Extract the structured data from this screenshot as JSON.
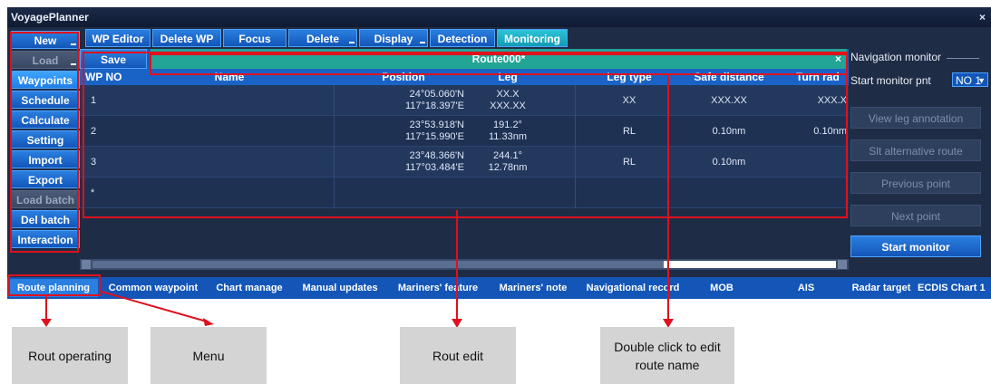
{
  "window": {
    "title": "VoyagePlanner",
    "close": "×"
  },
  "left_buttons": [
    {
      "label": "New",
      "state": "normal"
    },
    {
      "label": "Load",
      "state": "disabled"
    },
    {
      "label": "Waypoints",
      "state": "active"
    },
    {
      "label": "Schedule",
      "state": "normal"
    },
    {
      "label": "Calculate",
      "state": "normal"
    },
    {
      "label": "Setting",
      "state": "normal"
    },
    {
      "label": "Import",
      "state": "normal"
    },
    {
      "label": "Export",
      "state": "normal"
    },
    {
      "label": "Load batch",
      "state": "disabled"
    },
    {
      "label": "Del batch",
      "state": "normal"
    },
    {
      "label": "Interaction",
      "state": "normal"
    }
  ],
  "tabs": [
    "WP Editor",
    "Delete WP",
    "Focus",
    "Delete",
    "Display",
    "Detection",
    "Monitoring"
  ],
  "active_tab": "Monitoring",
  "toolbar": {
    "save_label": "Save",
    "route_name": "Route000*",
    "close": "×"
  },
  "table": {
    "columns": [
      "WP NO",
      "Name",
      "Position",
      "Leg",
      "Leg type",
      "Safe distance",
      "Turn rad"
    ],
    "rows": [
      {
        "wp_no": "1",
        "name": "",
        "lat": "24°05.060'N",
        "lon": "117°18.397'E",
        "leg1": "XX.X",
        "leg2": "XXX.XX",
        "leg_type": "XX",
        "safe": "XXX.XX",
        "turn": "XXX.X"
      },
      {
        "wp_no": "2",
        "name": "",
        "lat": "23°53.918'N",
        "lon": "117°15.990'E",
        "leg1": "191.2°",
        "leg2": "11.33nm",
        "leg_type": "RL",
        "safe": "0.10nm",
        "turn": "0.10nm"
      },
      {
        "wp_no": "3",
        "name": "",
        "lat": "23°48.366'N",
        "lon": "117°03.484'E",
        "leg1": "244.1°",
        "leg2": "12.78nm",
        "leg_type": "RL",
        "safe": "0.10nm",
        "turn": ""
      },
      {
        "wp_no": "*",
        "name": "",
        "lat": "",
        "lon": "",
        "leg1": "",
        "leg2": "",
        "leg_type": "",
        "safe": "",
        "turn": ""
      }
    ]
  },
  "nav_monitor": {
    "title": "Navigation monitor",
    "start_pnt_label": "Start monitor pnt",
    "start_pnt_value": "NO 1",
    "buttons": [
      {
        "label": "View leg annotation",
        "state": "disabled"
      },
      {
        "label": "Slt alternative route",
        "state": "disabled"
      },
      {
        "label": "Previous point",
        "state": "disabled"
      },
      {
        "label": "Next point",
        "state": "disabled"
      },
      {
        "label": "Start monitor",
        "state": "primary"
      }
    ]
  },
  "bottom_tabs": [
    "Route planning",
    "Common waypoint",
    "Chart manage",
    "Manual updates",
    "Mariners' feature",
    "Mariners' note",
    "Navigational record",
    "MOB",
    "AIS",
    "Radar target",
    "ECDIS Chart 1"
  ],
  "active_bottom_tab": "Route planning",
  "callouts": [
    "Rout  operating",
    "Menu",
    "Rout edit",
    "Double click to edit route name"
  ],
  "colors": {
    "annotation_red": "#e0101e",
    "accent_blue": "#1356b8",
    "route_teal": "#23a596"
  }
}
